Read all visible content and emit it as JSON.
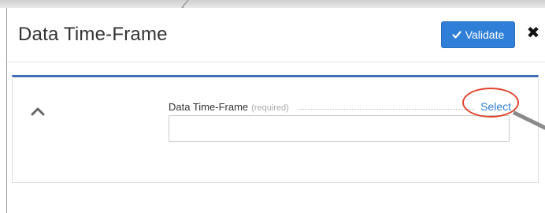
{
  "modal": {
    "title": "Data Time-Frame",
    "validate_label": "Validate",
    "close_label": "✖"
  },
  "panel": {
    "field": {
      "label": "Data Time-Frame",
      "required_note": "(required)",
      "select_label": "Select",
      "value": ""
    }
  },
  "colors": {
    "accent": "#2f7fd8",
    "panel_top_border": "#3c6fb4",
    "annotation": "#e0452e"
  },
  "icons": [
    "check-icon",
    "close-icon",
    "chevron-up-icon"
  ]
}
